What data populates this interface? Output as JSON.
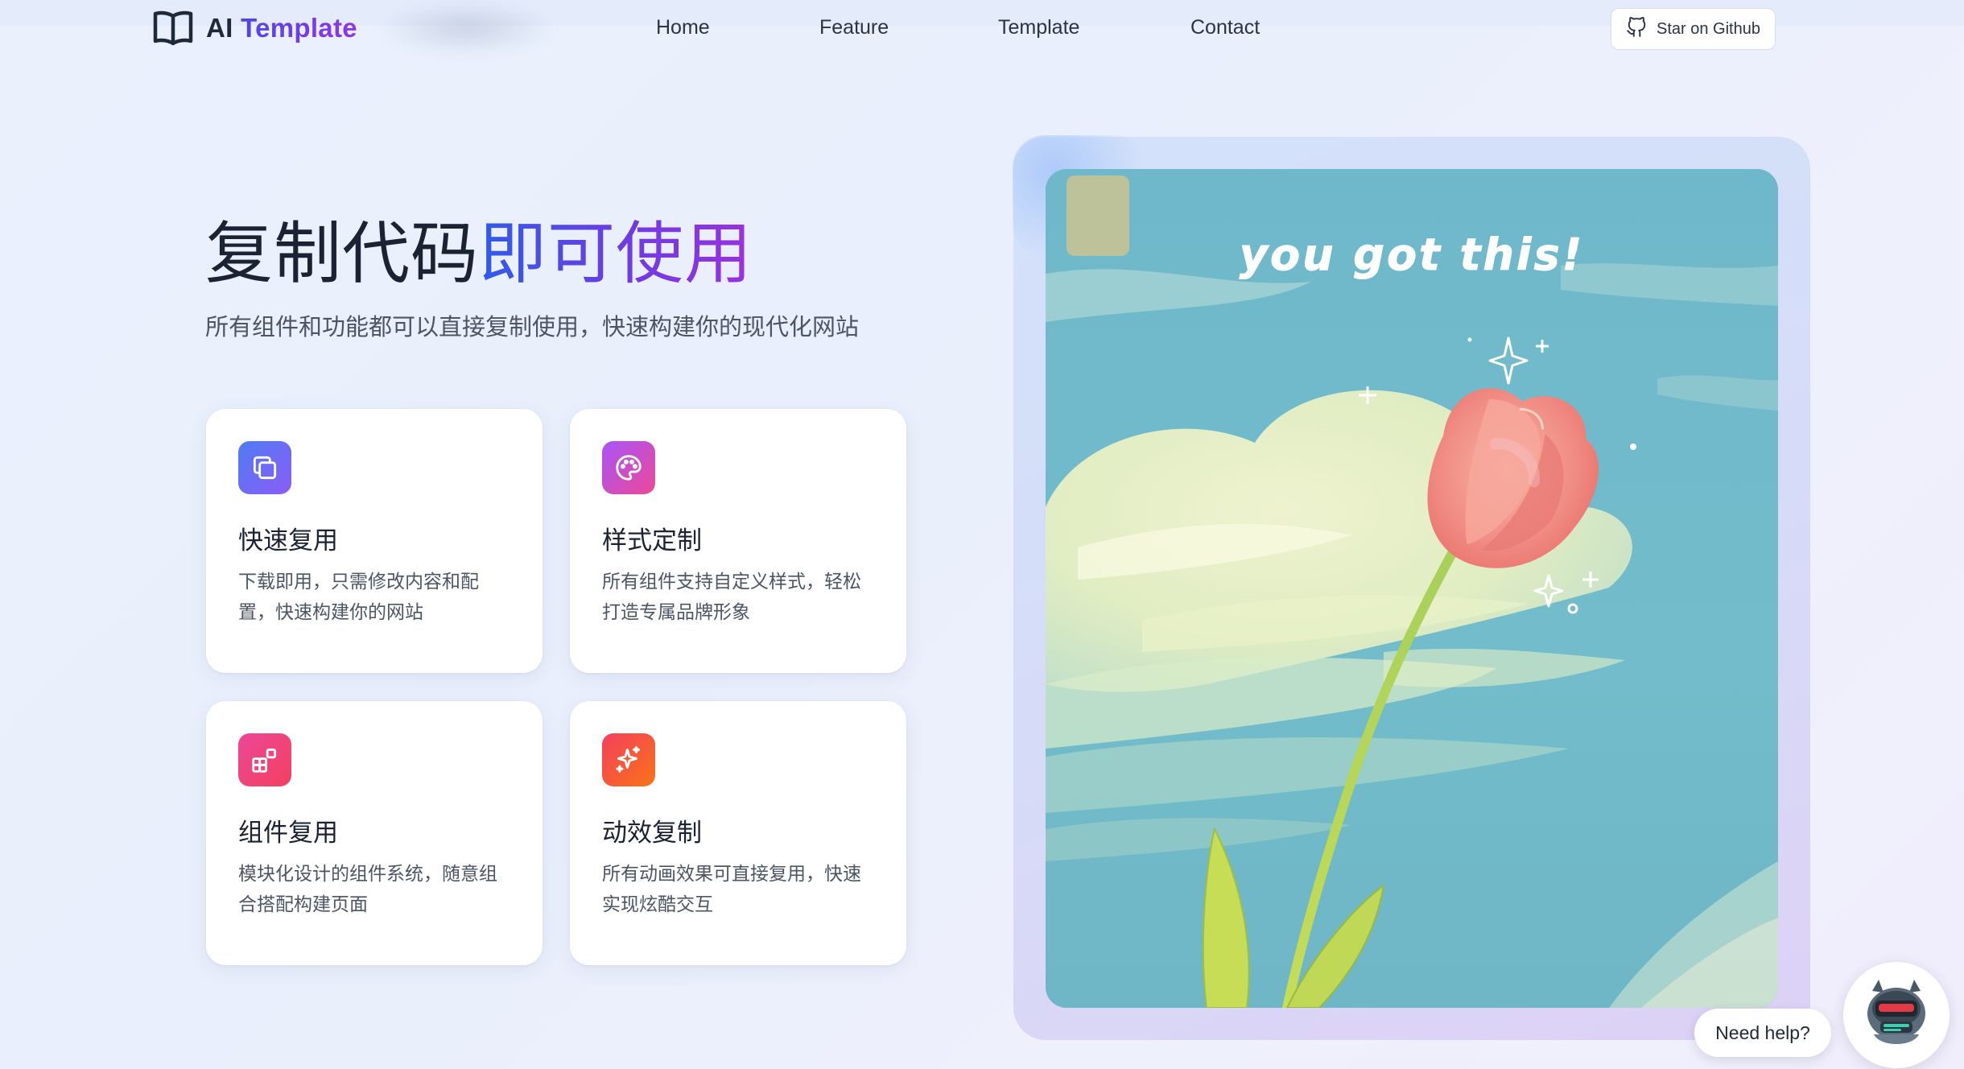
{
  "brand": {
    "name_plain": "AI",
    "name_accent": "Template"
  },
  "nav": {
    "items": [
      {
        "label": "Home"
      },
      {
        "label": "Feature"
      },
      {
        "label": "Template"
      },
      {
        "label": "Contact"
      }
    ],
    "github_label": "Star on Github"
  },
  "hero": {
    "title_plain": "复制代码",
    "title_accent": "即可使用",
    "subtitle": "所有组件和功能都可以直接复制使用，快速构建你的现代化网站"
  },
  "features": [
    {
      "title": "快速复用",
      "desc": "下载即用，只需修改内容和配置，快速构建你的网站",
      "icon": "copy-icon",
      "color": "#5b6cf2"
    },
    {
      "title": "样式定制",
      "desc": "所有组件支持自定义样式，轻松打造专属品牌形象",
      "icon": "palette-icon",
      "color": "#c04ad6"
    },
    {
      "title": "组件复用",
      "desc": "模块化设计的组件系统，随意组合搭配构建页面",
      "icon": "blocks-icon",
      "color": "#f0437a"
    },
    {
      "title": "动效复制",
      "desc": "所有动画效果可直接复用，快速实现炫酷交互",
      "icon": "sparkles-icon",
      "color": "#f25c2a"
    }
  ],
  "art": {
    "caption": "you got this!"
  },
  "chat": {
    "label": "Need help?",
    "icon": "robot-icon"
  },
  "colors": {
    "accent_blue": "#2f5be8",
    "accent_purple": "#9b30e0",
    "art_sky": "#72bccd"
  }
}
